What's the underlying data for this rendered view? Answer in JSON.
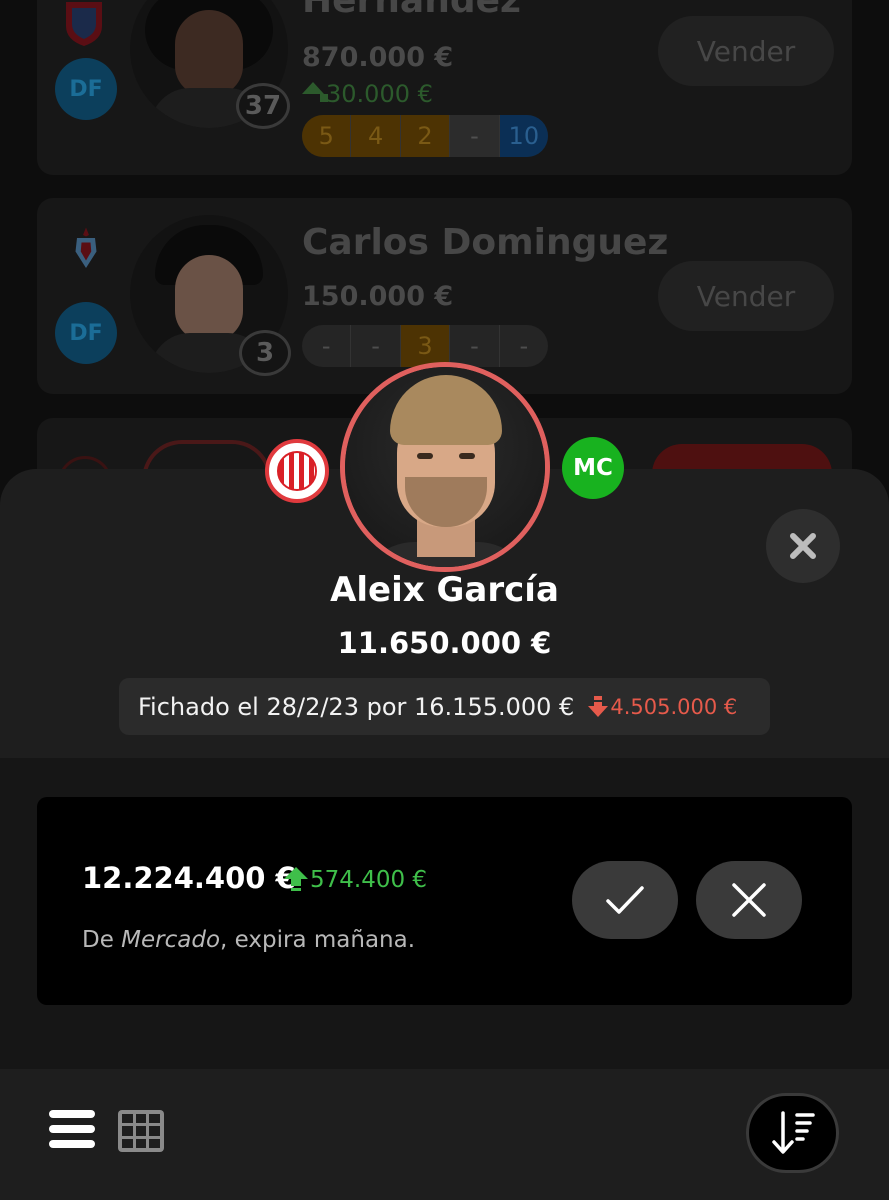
{
  "background_list": {
    "players": [
      {
        "name": "Hernandez",
        "value": "870.000 €",
        "delta": "30.000 €",
        "position": "DF",
        "number": "37",
        "scores": [
          "5",
          "4",
          "2",
          "-",
          "10"
        ],
        "sell_label": "Vender"
      },
      {
        "name": "Carlos Dominguez",
        "value": "150.000 €",
        "position": "DF",
        "number": "3",
        "scores": [
          "-",
          "-",
          "3",
          "-",
          "-"
        ],
        "sell_label": "Vender"
      }
    ]
  },
  "sheet": {
    "player_name": "Aleix García",
    "position": "MC",
    "club_icon": "girona-crest-icon",
    "market_value": "11.650.000 €",
    "signed_text": "Fichado el 28/2/23 por 16.155.000 €",
    "signed_loss": "4.505.000 €",
    "colors": {
      "avatar_ring": "#e0605e",
      "position_badge": "#18b21f",
      "loss": "#e65a4b",
      "gain": "#3fbf4a"
    }
  },
  "offer": {
    "amount": "12.224.400 €",
    "gain": "574.400 €",
    "source_prefix": "De ",
    "source_name": "Mercado",
    "source_suffix": ", expira mañana.",
    "accept_icon": "check-icon",
    "reject_icon": "close-icon"
  },
  "bottom_bar": {
    "list_view_icon": "list-icon",
    "grid_view_icon": "grid-icon",
    "sort_icon": "sort-descending-icon"
  }
}
